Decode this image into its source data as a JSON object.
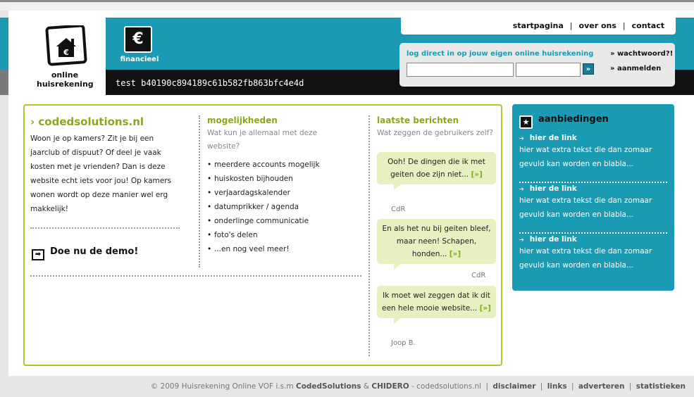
{
  "logo": {
    "line1": "online",
    "line2": "huisrekening",
    "icon": "house-euro-icon"
  },
  "header": {
    "badge_symbol": "€",
    "badge_label": "financieel",
    "test_text": "test b40190c894189c61b582fb863bfc4e4d"
  },
  "nav": {
    "items": [
      "startpagina",
      "over ons",
      "contact"
    ],
    "separator": "|"
  },
  "login": {
    "title": "log direct in op jouw eigen online huisrekening",
    "username_value": "",
    "password_value": "",
    "submit_label": "»",
    "forgot_label": "» wachtwoord?!",
    "register_label": "» aanmelden"
  },
  "intro": {
    "title": "› codedsolutions.nl",
    "text": "Woon je op kamers? Zit je bij een jaarclub of dispuut? Of deel je vaak kosten met je vrienden? Dan is deze website echt iets voor jou! Op kamers wonen wordt op deze manier wel erg makkelijk!",
    "demo_label": "Doe nu de demo!",
    "demo_icon": "➡"
  },
  "features": {
    "title": "mogelijkheden",
    "subtitle": "Wat kun je allemaal met deze website?",
    "items": [
      "meerdere accounts mogelijk",
      "huiskosten bijhouden",
      "verjaardagskalender",
      "datumprikker / agenda",
      "onderlinge communicatie",
      "foto's delen",
      "...en nog veel meer!"
    ]
  },
  "posts": {
    "title": "laatste berichten",
    "subtitle": "Wat zeggen de gebruikers zelf?",
    "more_label": "[»]",
    "items": [
      {
        "text": "Ooh! De dingen die ik met geiten doe zijn niet...",
        "author": "CdR"
      },
      {
        "text": "En als het nu bij geiten bleef, maar neen! Schapen, honden...",
        "author": "CdR"
      },
      {
        "text": "Ik moet wel zeggen dat ik dit een hele mooie website...",
        "author": "Joop B."
      }
    ]
  },
  "offers": {
    "title": "aanbiedingen",
    "icon": "★",
    "items": [
      {
        "link": "hier de link",
        "text": "hier wat extra tekst die dan zomaar gevuld kan worden en blabla..."
      },
      {
        "link": "hier de link",
        "text": "hier wat extra tekst die dan zomaar gevuld kan worden en blabla..."
      },
      {
        "link": "hier de link",
        "text": "hier wat extra tekst die dan zomaar gevuld kan worden en blabla..."
      }
    ]
  },
  "footer": {
    "copyright": "© 2009 Huisrekening Online VOF i.s.m",
    "partner1": "CodedSolutions",
    "amp": "&",
    "partner2": "CHIDERO",
    "domain": "- codedsolutions.nl",
    "links": [
      "disclaimer",
      "links",
      "adverteren",
      "statistieken"
    ]
  },
  "colors": {
    "teal": "#1a9bb3",
    "lime": "#a8c82b",
    "bubble": "#e6f0c0",
    "black": "#111111"
  }
}
